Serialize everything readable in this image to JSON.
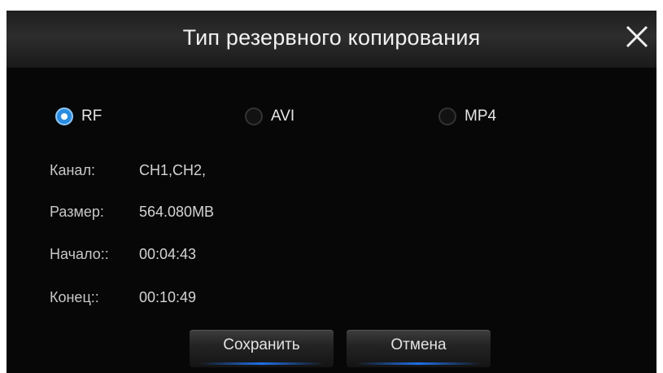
{
  "dialog": {
    "title": "Тип резервного копирования",
    "close_icon": "close-icon"
  },
  "format_options": [
    {
      "label": "RF",
      "selected": true
    },
    {
      "label": "AVI",
      "selected": false
    },
    {
      "label": "MP4",
      "selected": false
    }
  ],
  "fields": {
    "channel": {
      "label": "Канал:",
      "value": "CH1,CH2,"
    },
    "size": {
      "label": "Размер:",
      "value": "564.080MB"
    },
    "start": {
      "label": "Начало::",
      "value": "00:04:43"
    },
    "end": {
      "label": "Конец::",
      "value": "00:10:49"
    }
  },
  "buttons": {
    "save_label": "Сохранить",
    "cancel_label": "Отмена"
  },
  "colors": {
    "accent": "#2a8ce0",
    "button_underline": "#1f6fe8",
    "background": "#070707"
  }
}
